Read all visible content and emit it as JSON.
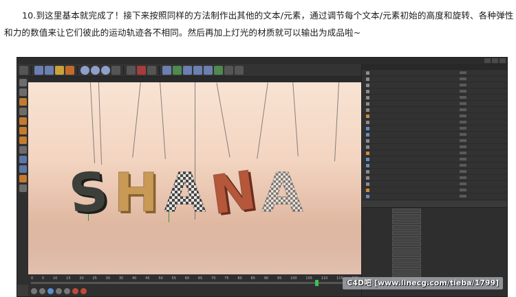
{
  "article": {
    "line1": "10.到这里基本就完成了！接下来按照同样的方法制作出其他的文本/元素，通过调节每个文本/元素初始的高度和旋转、各种弹性",
    "line2": "和力的数值来让它们彼此的运动轨迹各不相同。然后再加上灯光的材质就可以输出为成品啦~"
  },
  "screenshot": {
    "viewport_letters": [
      "S",
      "H",
      "A",
      "N",
      "A"
    ],
    "timeline_ticks": [
      "0",
      "5",
      "10",
      "15",
      "20",
      "25",
      "30",
      "35",
      "40",
      "45",
      "50",
      "55",
      "60",
      "65",
      "70",
      "75",
      "80",
      "85",
      "90",
      "95",
      "100",
      "105",
      "110",
      "115",
      "120"
    ],
    "frame_marker": "116",
    "watermark": "C4D吧 [www.linecg.com/tieba/1799]"
  },
  "colors": {
    "viewport_bg": "#f3d5c1",
    "ui_dark": "#3b3b3b",
    "marker_green": "#3cbf5a"
  }
}
